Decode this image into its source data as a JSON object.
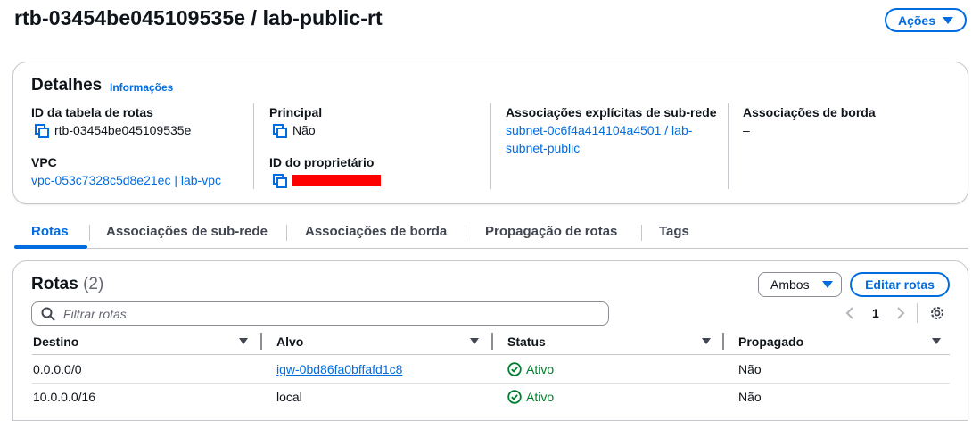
{
  "header": {
    "title": "rtb-03454be045109535e / lab-public-rt",
    "actions_label": "Ações"
  },
  "details": {
    "title": "Detalhes",
    "info_link": "Informações",
    "route_table_id_label": "ID da tabela de rotas",
    "route_table_id_value": "rtb-03454be045109535e",
    "vpc_label": "VPC",
    "vpc_value": "vpc-053c7328c5d8e21ec | lab-vpc",
    "main_label": "Principal",
    "main_value": "Não",
    "owner_label": "ID do proprietário",
    "explicit_assoc_label": "Associações explícitas de sub-rede",
    "explicit_assoc_line1": "subnet-0c6f4a414104a4501 / lab-",
    "explicit_assoc_line2": "subnet-public",
    "edge_assoc_label": "Associações de borda",
    "edge_assoc_value": "–"
  },
  "tabs": [
    {
      "label": "Rotas",
      "active": true
    },
    {
      "label": "Associações de sub-rede",
      "active": false
    },
    {
      "label": "Associações de borda",
      "active": false
    },
    {
      "label": "Propagação de rotas",
      "active": false
    },
    {
      "label": "Tags",
      "active": false
    }
  ],
  "routes": {
    "title": "Rotas",
    "count": "(2)",
    "filter_select": "Ambos",
    "edit_button": "Editar rotas",
    "search_placeholder": "Filtrar rotas",
    "page_number": "1",
    "columns": [
      "Destino",
      "Alvo",
      "Status",
      "Propagado"
    ],
    "rows": [
      {
        "destination": "0.0.0.0/0",
        "target": "igw-0bd86fa0bffafd1c8",
        "target_is_link": true,
        "status": "Ativo",
        "propagated": "Não"
      },
      {
        "destination": "10.0.0.0/16",
        "target": "local",
        "target_is_link": false,
        "status": "Ativo",
        "propagated": "Não"
      }
    ]
  },
  "colors": {
    "accent": "#006ce0",
    "success": "#00802f",
    "redaction": "#ff0000"
  },
  "icons": [
    "copy-icon",
    "caret-down-icon",
    "search-icon",
    "chevron-left-icon",
    "chevron-right-icon",
    "settings-gear-icon",
    "status-check-icon",
    "sort-caret-icon"
  ]
}
